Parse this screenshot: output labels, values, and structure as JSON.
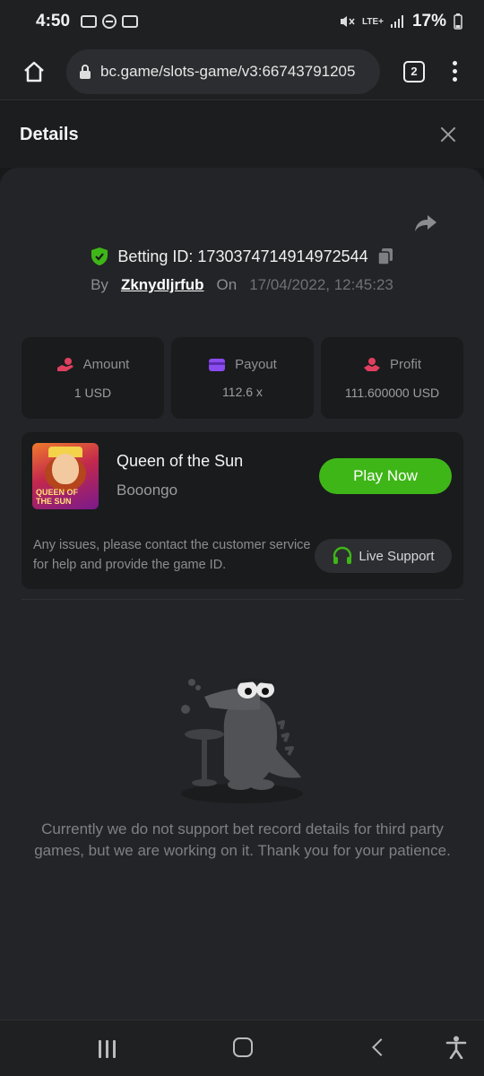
{
  "status_bar": {
    "time": "4:50",
    "network": "LTE+",
    "battery": "17%"
  },
  "browser": {
    "url": "bc.game/slots-game/v3:66743791205",
    "tab_count": "2"
  },
  "details": {
    "title": "Details",
    "betting_label": "Betting ID: 1730374714914972544",
    "by_label": "By",
    "username": "Zknydljrfub",
    "on_label": "On",
    "datetime": "17/04/2022, 12:45:23"
  },
  "stats": {
    "amount": {
      "label": "Amount",
      "value": "1 USD",
      "icon": "coin-hand-icon",
      "color": "#e0405f"
    },
    "payout": {
      "label": "Payout",
      "value": "112.6 x",
      "icon": "wallet-icon",
      "color": "#8a4bef"
    },
    "profit": {
      "label": "Profit",
      "value": "111.600000 USD",
      "icon": "profit-hand-icon",
      "color": "#e0405f"
    }
  },
  "game": {
    "name": "Queen of the Sun",
    "provider": "Booongo",
    "thumb_title": "QUEEN OF THE SUN",
    "play_label": "Play Now",
    "issues_text": "Any issues, please contact the customer service for help and provide the game ID.",
    "support_label": "Live Support"
  },
  "notice": "Currently we do not support bet record details for third party games, but we are working on it. Thank you for your patience.",
  "colors": {
    "accent_green": "#3fb618",
    "background": "#18191b",
    "panel": "#232427"
  }
}
